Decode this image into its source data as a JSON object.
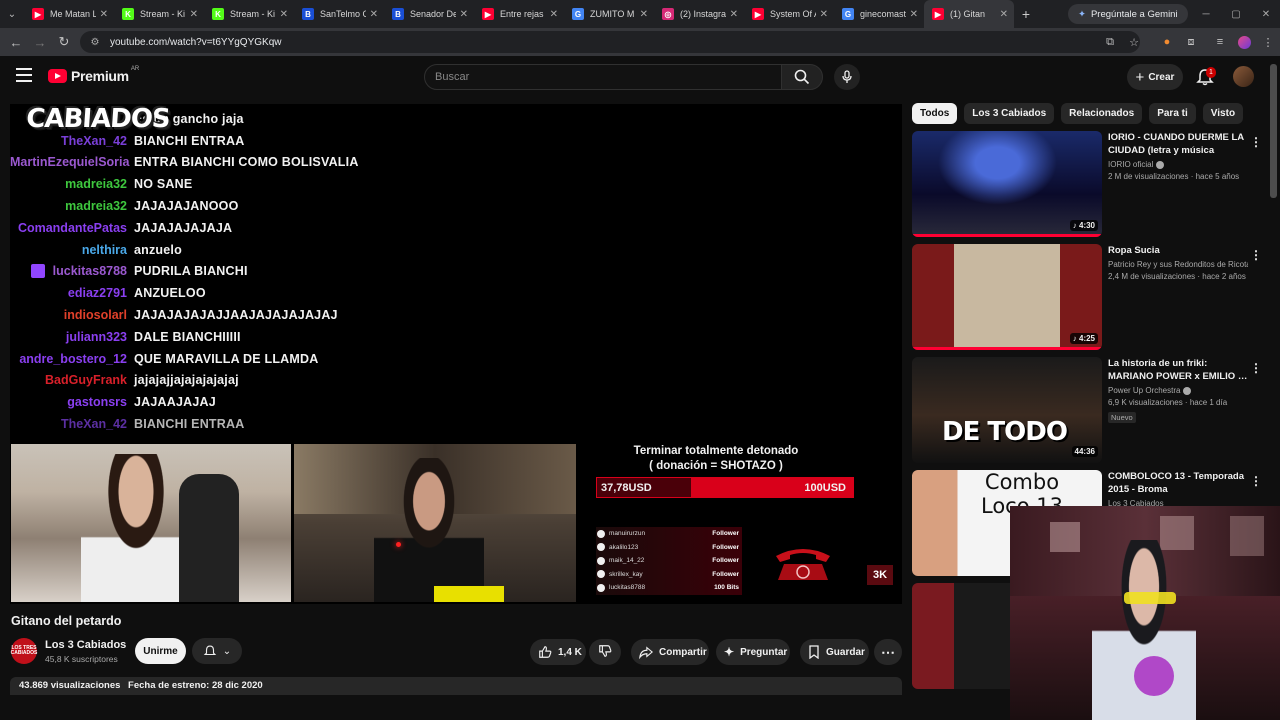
{
  "browser": {
    "tabs": [
      {
        "label": "Me Matan L",
        "color": "#ff0033",
        "glyph": "▶"
      },
      {
        "label": "Stream - Ki",
        "color": "#53fc18",
        "glyph": "K"
      },
      {
        "label": "Stream - Ki",
        "color": "#53fc18",
        "glyph": "K"
      },
      {
        "label": "SanTelmo C",
        "color": "#1a4fd6",
        "glyph": "B"
      },
      {
        "label": "Senador De",
        "color": "#1a4fd6",
        "glyph": "B"
      },
      {
        "label": "Entre rejas",
        "color": "#ff0033",
        "glyph": "▶"
      },
      {
        "label": "ZUMITO M",
        "color": "#4285f4",
        "glyph": "G"
      },
      {
        "label": "(2) Instagra",
        "color": "#d62976",
        "glyph": "◎"
      },
      {
        "label": "System Of A",
        "color": "#ff0033",
        "glyph": "▶"
      },
      {
        "label": "ginecomast",
        "color": "#4285f4",
        "glyph": "G"
      },
      {
        "label": "(1) Gitan",
        "color": "#ff0033",
        "glyph": "▶"
      }
    ],
    "gemini_label": "Pregúntale a Gemini",
    "url": "youtube.com/watch?v=t6YYgQYGKqw"
  },
  "header": {
    "logo_text": "Premium",
    "logo_country": "AR",
    "search_placeholder": "Buscar",
    "create_label": "Crear",
    "notif_count": "1"
  },
  "player": {
    "channel_logo": "CABIADOS",
    "chat": [
      {
        "user": "",
        "color": "#f2f2f2",
        "msg": "Es un gancho jaja"
      },
      {
        "user": "TheXan_42",
        "color": "#7a3fd8",
        "msg": "BIANCHI ENTRAA"
      },
      {
        "user": "MartinEzequielSoria",
        "color": "#9b59d0",
        "msg": "ENTRA BIANCHI COMO BOLISVALIA"
      },
      {
        "user": "madreia32",
        "color": "#3ec73e",
        "msg": "NO SANE"
      },
      {
        "user": "madreia32",
        "color": "#3ec73e",
        "msg": "JAJAJAJANOOO"
      },
      {
        "user": "ComandantePatas",
        "color": "#8a3ff0",
        "msg": "JAJAJAJAJAJA"
      },
      {
        "user": "nelthira",
        "color": "#4aa8e8",
        "msg": "anzuelo"
      },
      {
        "user": "luckitas8788",
        "color": "#9b59d0",
        "msg": "PUDRILA BIANCHI",
        "badge": true
      },
      {
        "user": "ediaz2791",
        "color": "#8a3ff0",
        "msg": "ANZUELOO"
      },
      {
        "user": "indiosolarl",
        "color": "#e0402a",
        "msg": "JAJAJAJAJAJJAAJAJAJAJAJAJ"
      },
      {
        "user": "juliann323",
        "color": "#8a3ff0",
        "msg": "DALE BIANCHIIIII"
      },
      {
        "user": "andre_bostero_12",
        "color": "#8a3ff0",
        "msg": "QUE MARAVILLA DE LLAMDA"
      },
      {
        "user": "BadGuyFrank",
        "color": "#d8202a",
        "msg": "jajajajjajajajajajaj"
      },
      {
        "user": "gastonsrs",
        "color": "#8a3ff0",
        "msg": "JAJAAJAJAJ"
      },
      {
        "user": "TheXan_42",
        "color": "#7a3fd8",
        "msg": "BIANCHI ENTRAA"
      }
    ],
    "goal_title": "Terminar totalmente detonado",
    "goal_subtitle": "( donación = SHOTAZO )",
    "goal_current": "37,78USD",
    "goal_target": "100USD",
    "goal_progress": 0.3778,
    "followers": [
      {
        "name": "manuirurzun",
        "type": "Follower"
      },
      {
        "name": "akalilo123",
        "type": "Follower"
      },
      {
        "name": "maik_14_22",
        "type": "Follower"
      },
      {
        "name": "skrillex_kay",
        "type": "Follower"
      },
      {
        "name": "luckitas8788",
        "type": "100 Bits"
      }
    ],
    "counter": "3K"
  },
  "video": {
    "title": "Gitano del petardo",
    "channel": "Los 3 Cabiados",
    "channel_avatar_text": "LOS TRES CABIADOS",
    "subscribers": "45,8 K suscriptores",
    "join_label": "Unirme",
    "likes": "1,4 K",
    "share_label": "Compartir",
    "ask_label": "Preguntar",
    "save_label": "Guardar",
    "views": "43.869 visualizaciones",
    "premiere": "Fecha de estreno: 28 dic 2020"
  },
  "sidebar": {
    "chips": [
      "Todos",
      "Los 3 Cabiados",
      "Relacionados",
      "Para ti",
      "Visto"
    ],
    "recs": [
      {
        "title": "IORIO - CUANDO DUERME LA CIUDAD (letra y música Ricard…",
        "channel": "IORIO oficial",
        "meta": "2 M de visualizaciones · hace 5 años",
        "duration": "♪ 4:30",
        "verified": true,
        "watched": 1.0
      },
      {
        "title": "Ropa Sucia",
        "channel": "Patricio Rey y sus Redonditos de Ricota",
        "meta": "2,4 M de visualizaciones · hace 2 años",
        "duration": "♪ 4:25",
        "verified": true,
        "watched": 1.0
      },
      {
        "title": "La historia de un friki: MARIANO POWER x EMILIO …",
        "channel": "Power Up Orchestra",
        "meta": "6,9 K visualizaciones · hace 1 día",
        "duration": "44:36",
        "verified": true,
        "badge": "Nuevo",
        "thumb_text": "DE TODO",
        "watched": 0
      },
      {
        "title": "COMBOLOCO 13 - Temporada 2015 - Broma",
        "channel": "Los 3 Cabiados",
        "meta": "",
        "duration": "",
        "thumb_text": "Combo Loco 13",
        "watched": 0
      }
    ]
  }
}
